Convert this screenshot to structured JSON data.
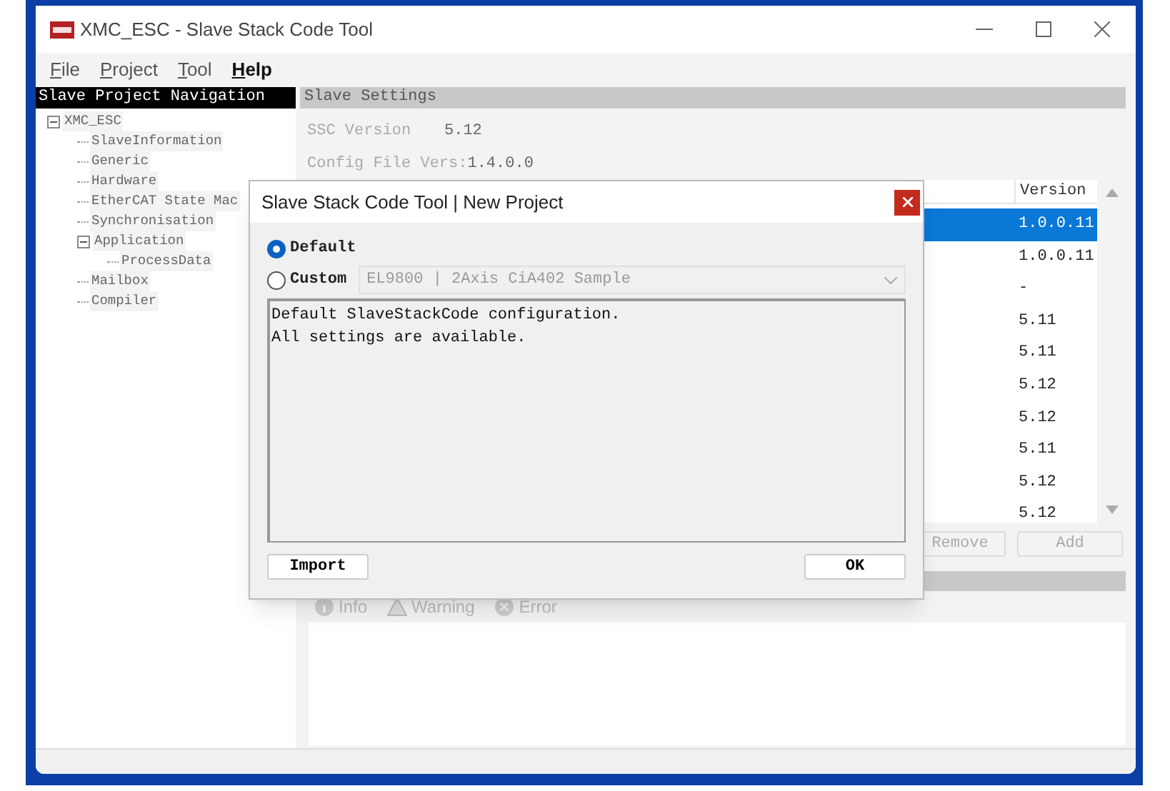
{
  "window": {
    "title": "XMC_ESC - Slave Stack Code Tool"
  },
  "menu": [
    {
      "label": "File"
    },
    {
      "label": "Project"
    },
    {
      "label": "Tool"
    },
    {
      "label": "Help"
    }
  ],
  "navigation": {
    "title": "Slave Project Navigation",
    "tree": [
      {
        "label": "XMC_ESC",
        "expanded": true,
        "children": [
          {
            "label": "SlaveInformation"
          },
          {
            "label": "Generic"
          },
          {
            "label": "Hardware"
          },
          {
            "label": "EtherCAT State Mac"
          },
          {
            "label": "Synchronisation"
          },
          {
            "label": "Application",
            "expanded": true,
            "children": [
              {
                "label": "ProcessData"
              }
            ]
          },
          {
            "label": "Mailbox"
          },
          {
            "label": "Compiler"
          }
        ]
      }
    ]
  },
  "settings": {
    "title": "Slave Settings",
    "ssc_version_label": "SSC Version",
    "ssc_version": "5.12",
    "config_label": "Config File Vers:",
    "config_version": "1.4.0.0",
    "table": {
      "version_header": "Version",
      "rows": [
        {
          "version": "1.0.0.11",
          "selected": true
        },
        {
          "version": "1.0.0.11",
          "selected": false
        },
        {
          "version": "-",
          "selected": false
        },
        {
          "version": "5.11",
          "selected": false
        },
        {
          "version": "5.11",
          "selected": false
        },
        {
          "version": "5.12",
          "selected": false
        },
        {
          "version": "5.12",
          "selected": false
        },
        {
          "version": "5.11",
          "selected": false
        },
        {
          "version": "5.12",
          "selected": false
        },
        {
          "version": "5.12",
          "selected": false
        }
      ]
    },
    "buttons": [
      {
        "label": "Remove",
        "disabled": true
      },
      {
        "label": "Add",
        "disabled": true
      }
    ],
    "log_tabs": [
      {
        "label": "Info",
        "kind": "info"
      },
      {
        "label": "Warning",
        "kind": "warning"
      },
      {
        "label": "Error",
        "kind": "error"
      }
    ]
  },
  "dialog": {
    "title": "Slave Stack Code Tool | New Project",
    "options": [
      {
        "label": "Default",
        "selected": true
      },
      {
        "label": "Custom",
        "selected": false
      }
    ],
    "custom_select": {
      "value": "EL9800 | 2Axis CiA402 Sample",
      "disabled": true
    },
    "description": [
      "Default SlaveStackCode configuration.",
      "All settings are available."
    ],
    "import_button": "Import",
    "ok_button": "OK"
  }
}
